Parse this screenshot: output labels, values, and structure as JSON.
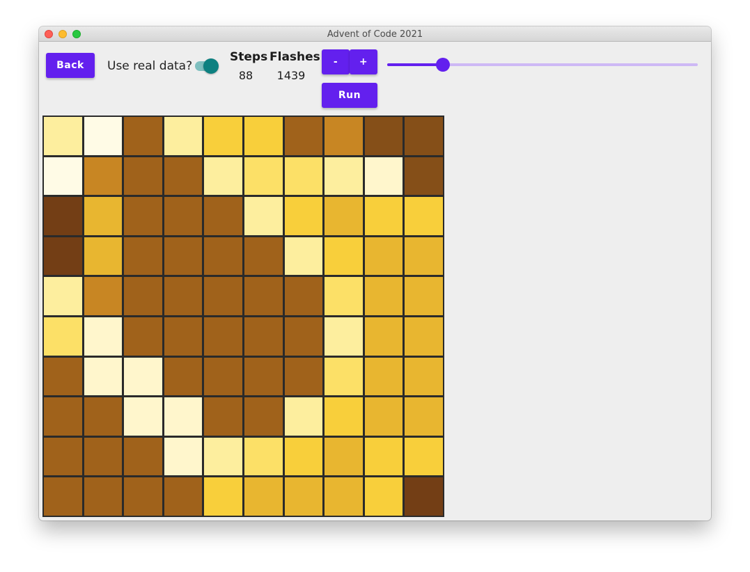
{
  "window": {
    "title": "Advent of Code 2021"
  },
  "toolbar": {
    "back_label": "Back",
    "real_data_label": "Use real data?",
    "real_data_on": true,
    "steps_header": "Steps",
    "flashes_header": "Flashes",
    "steps_value": "88",
    "flashes_value": "1439",
    "minus_label": "-",
    "plus_label": "+",
    "run_label": "Run",
    "slider_fraction": 0.18
  },
  "colors": {
    "accent": "#6320ee",
    "toggle_on": "#0d8080",
    "levels": [
      "#fffbe6",
      "#fff6cc",
      "#fdee9e",
      "#fce067",
      "#f8cf3b",
      "#e8b630",
      "#c88623",
      "#a0621b",
      "#854f18",
      "#733e15"
    ]
  },
  "grid": {
    "levels": [
      [
        2,
        0,
        7,
        2,
        4,
        4,
        7,
        6,
        8,
        8
      ],
      [
        0,
        6,
        7,
        7,
        2,
        3,
        3,
        2,
        1,
        8
      ],
      [
        9,
        5,
        7,
        7,
        7,
        2,
        4,
        5,
        4,
        4
      ],
      [
        9,
        5,
        7,
        7,
        7,
        7,
        2,
        4,
        5,
        5
      ],
      [
        2,
        6,
        7,
        7,
        7,
        7,
        7,
        3,
        5,
        5
      ],
      [
        3,
        1,
        7,
        7,
        7,
        7,
        7,
        2,
        5,
        5
      ],
      [
        7,
        1,
        1,
        7,
        7,
        7,
        7,
        3,
        5,
        5
      ],
      [
        7,
        7,
        1,
        1,
        7,
        7,
        2,
        4,
        5,
        5
      ],
      [
        7,
        7,
        7,
        1,
        2,
        3,
        4,
        5,
        4,
        4
      ],
      [
        7,
        7,
        7,
        7,
        4,
        5,
        5,
        5,
        4,
        9
      ]
    ]
  }
}
